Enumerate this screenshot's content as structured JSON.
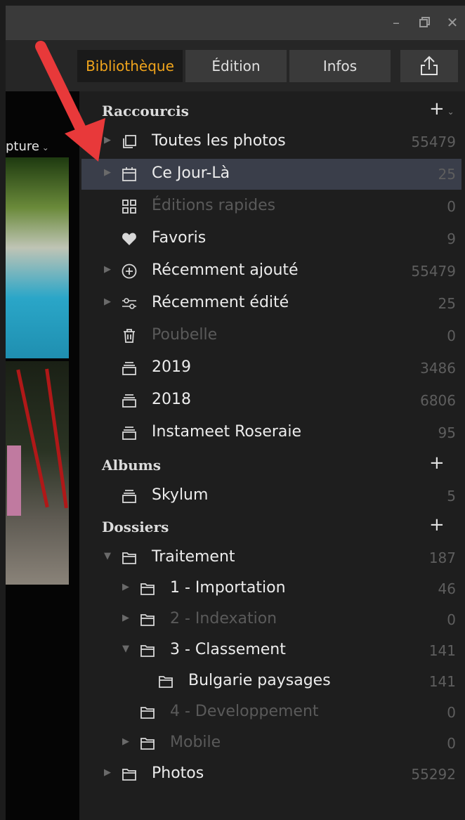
{
  "tabs": [
    {
      "label": "Bibliothèque",
      "active": true
    },
    {
      "label": "Édition",
      "active": false
    },
    {
      "label": "Infos",
      "active": false
    }
  ],
  "left": {
    "capture_label": "pture"
  },
  "sidebar": {
    "raccourcis": {
      "title": "Raccourcis",
      "items": [
        {
          "label": "Toutes les photos",
          "count": "55479",
          "icon": "photos-icon"
        },
        {
          "label": "Ce Jour-Là",
          "count": "25",
          "icon": "calendar-icon"
        },
        {
          "label": "Éditions rapides",
          "count": "0",
          "icon": "grid-icon"
        },
        {
          "label": "Favoris",
          "count": "9",
          "icon": "heart-icon"
        },
        {
          "label": "Récemment ajouté",
          "count": "55479",
          "icon": "plus-circle-icon"
        },
        {
          "label": "Récemment édité",
          "count": "25",
          "icon": "sliders-icon"
        },
        {
          "label": "Poubelle",
          "count": "0",
          "icon": "trash-icon"
        },
        {
          "label": "2019",
          "count": "3486",
          "icon": "album-icon"
        },
        {
          "label": "2018",
          "count": "6806",
          "icon": "album-icon"
        },
        {
          "label": "Instameet Roseraie",
          "count": "95",
          "icon": "album-icon"
        }
      ]
    },
    "albums": {
      "title": "Albums",
      "items": [
        {
          "label": "Skylum",
          "count": "5",
          "icon": "album-icon"
        }
      ]
    },
    "dossiers": {
      "title": "Dossiers",
      "items": [
        {
          "label": "Traitement",
          "count": "187",
          "icon": "folder-icon"
        },
        {
          "label": "1 - Importation",
          "count": "46",
          "icon": "folder-icon"
        },
        {
          "label": "2 - Indexation",
          "count": "0",
          "icon": "folder-icon"
        },
        {
          "label": "3 - Classement",
          "count": "141",
          "icon": "folder-icon"
        },
        {
          "label": "Bulgarie paysages",
          "count": "141",
          "icon": "folder-icon"
        },
        {
          "label": "4 - Developpement",
          "count": "0",
          "icon": "folder-icon"
        },
        {
          "label": "Mobile",
          "count": "0",
          "icon": "folder-icon"
        },
        {
          "label": "Photos",
          "count": "55292",
          "icon": "folder-icon"
        }
      ]
    }
  },
  "colors": {
    "accent": "#f0a41c",
    "selected_row": "#3a3e4a",
    "annotation_arrow": "#e8393a"
  }
}
